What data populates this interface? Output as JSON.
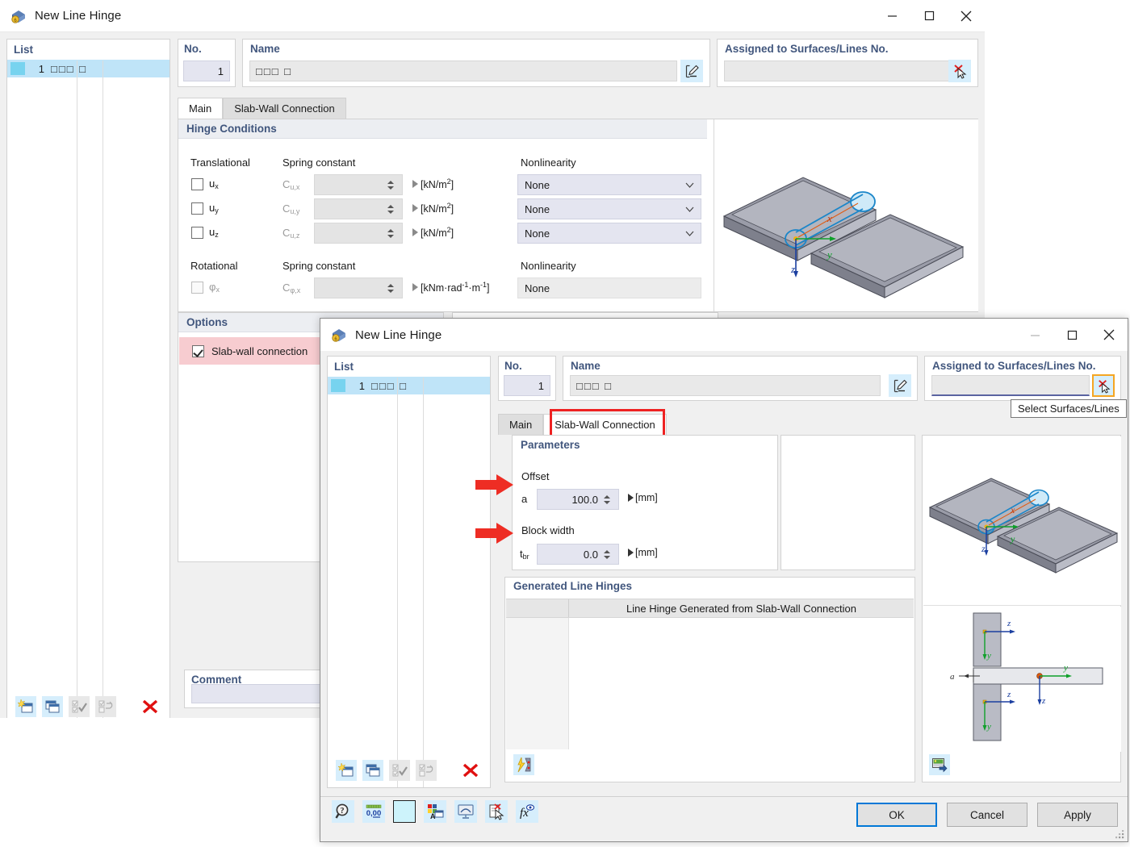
{
  "dialog1": {
    "title": "New Line Hinge",
    "title_icon": "line-hinge-icon",
    "window_buttons": {
      "minimize": "minimize-icon",
      "maximize": "maximize-icon",
      "close": "close-icon"
    },
    "list": {
      "header": "List",
      "rows": [
        {
          "number": "1",
          "name": "□□□ □"
        }
      ]
    },
    "no": {
      "label": "No.",
      "value": "1"
    },
    "name": {
      "label": "Name",
      "value": "□□□ □",
      "edit_icon": "pencil-edit-icon"
    },
    "assigned": {
      "label": "Assigned to Surfaces/Lines No.",
      "value": "",
      "select_icon": "select-surfaces-lines-icon"
    },
    "tabs": [
      {
        "label": "Main",
        "active": true
      },
      {
        "label": "Slab-Wall Connection",
        "active": false
      }
    ],
    "hinge_conditions": {
      "title": "Hinge Conditions",
      "col_translational": "Translational",
      "col_spring": "Spring constant",
      "col_nonlinearity": "Nonlinearity",
      "col_rotational": "Rotational",
      "translational_rows": [
        {
          "checked": false,
          "dof": "u",
          "dof_sub": "x",
          "const": "C",
          "const_sub": "u,x",
          "value": "",
          "unit_pre": "[kN/m",
          "unit_sup": "2",
          "unit_post": "]",
          "nonlinearity": "None"
        },
        {
          "checked": false,
          "dof": "u",
          "dof_sub": "y",
          "const": "C",
          "const_sub": "u,y",
          "value": "",
          "unit_pre": "[kN/m",
          "unit_sup": "2",
          "unit_post": "]",
          "nonlinearity": "None"
        },
        {
          "checked": false,
          "dof": "u",
          "dof_sub": "z",
          "const": "C",
          "const_sub": "u,z",
          "value": "",
          "unit_pre": "[kN/m",
          "unit_sup": "2",
          "unit_post": "]",
          "nonlinearity": "None"
        }
      ],
      "rotational_rows": [
        {
          "checked": false,
          "dof": "φ",
          "dof_sub": "x",
          "const": "C",
          "const_sub": "φ,x",
          "value": "",
          "unit_pre": "[kNm·rad",
          "unit_sup": "-1",
          "unit_mid": "·m",
          "unit_sup2": "-1",
          "unit_post": "]",
          "nonlinearity": "None"
        }
      ]
    },
    "options": {
      "title": "Options",
      "checkbox_label": "Slab-wall connection",
      "checked": true,
      "highlight_color": "#f7ccd0"
    },
    "comment": {
      "title": "Comment",
      "value": ""
    },
    "list_toolbar": [
      {
        "name": "new-item-button",
        "icon": "new-window-star-icon",
        "enabled": true
      },
      {
        "name": "copy-item-button",
        "icon": "copy-window-icon",
        "enabled": true
      },
      {
        "name": "check-all-button",
        "icon": "check-all-icon",
        "enabled": false
      },
      {
        "name": "invert-check-button",
        "icon": "invert-check-icon",
        "enabled": false
      },
      {
        "name": "delete-item-button",
        "icon": "red-x-delete-icon",
        "enabled": true
      }
    ]
  },
  "dialog2": {
    "title": "New Line Hinge",
    "title_icon": "line-hinge-icon",
    "window_buttons": {
      "minimize": "minimize-icon",
      "maximize": "maximize-icon",
      "close": "close-icon"
    },
    "list": {
      "header": "List",
      "rows": [
        {
          "number": "1",
          "name": "□□□ □"
        }
      ]
    },
    "no": {
      "label": "No.",
      "value": "1"
    },
    "name": {
      "label": "Name",
      "value": "□□□ □",
      "edit_icon": "pencil-edit-icon"
    },
    "assigned": {
      "label": "Assigned to Surfaces/Lines No.",
      "value": "",
      "select_icon": "select-surfaces-lines-icon",
      "button_highlighted": true,
      "tooltip": "Select Surfaces/Lines"
    },
    "tabs": [
      {
        "label": "Main",
        "active": false
      },
      {
        "label": "Slab-Wall Connection",
        "active": true,
        "annotated": true
      }
    ],
    "parameters": {
      "title": "Parameters",
      "offset": {
        "group_label": "Offset",
        "symbol": "a",
        "value": "100.0",
        "unit": "[mm]",
        "annotated": true
      },
      "block_width": {
        "group_label": "Block width",
        "symbol": "t",
        "symbol_sub": "br",
        "value": "0.0",
        "unit": "[mm]",
        "annotated": true
      }
    },
    "generated": {
      "title": "Generated Line Hinges",
      "columns": [
        "",
        "Line Hinge Generated from Slab-Wall Connection"
      ],
      "rows": [],
      "footer_icon": "generate-lightning-icon"
    },
    "graphics": {
      "top_view_labels": {
        "x": "x",
        "y": "y",
        "z": "z"
      },
      "section_labels": {
        "a": "a",
        "y": "y",
        "z": "z"
      },
      "footer_icon": "picture-export-icon"
    },
    "bottom_toolbar": [
      {
        "name": "help-search-button",
        "icon": "magnifier-question-icon"
      },
      {
        "name": "decimal-places-button",
        "icon": "decimals-0-00-icon"
      },
      {
        "name": "color-swatch-button",
        "icon": "color-swatch-icon"
      },
      {
        "name": "display-properties-button",
        "icon": "color-palette-icon"
      },
      {
        "name": "view-mode-button",
        "icon": "monitor-icon"
      },
      {
        "name": "clear-assignment-button",
        "icon": "document-red-x-icon"
      },
      {
        "name": "formula-button",
        "icon": "fx-formula-icon"
      }
    ],
    "list_toolbar": [
      {
        "name": "new-item-button",
        "icon": "new-window-star-icon",
        "enabled": true
      },
      {
        "name": "copy-item-button",
        "icon": "copy-window-icon",
        "enabled": true
      },
      {
        "name": "check-all-button",
        "icon": "check-all-icon",
        "enabled": false
      },
      {
        "name": "invert-check-button",
        "icon": "invert-check-icon",
        "enabled": false
      },
      {
        "name": "delete-item-button",
        "icon": "red-x-delete-icon",
        "enabled": true
      }
    ],
    "buttons": {
      "ok": "OK",
      "cancel": "Cancel",
      "apply": "Apply"
    }
  },
  "annotations": {
    "arrow_color": "#ee2d24",
    "box_color": "#ee2222",
    "highlight_color": "#f5a623"
  }
}
